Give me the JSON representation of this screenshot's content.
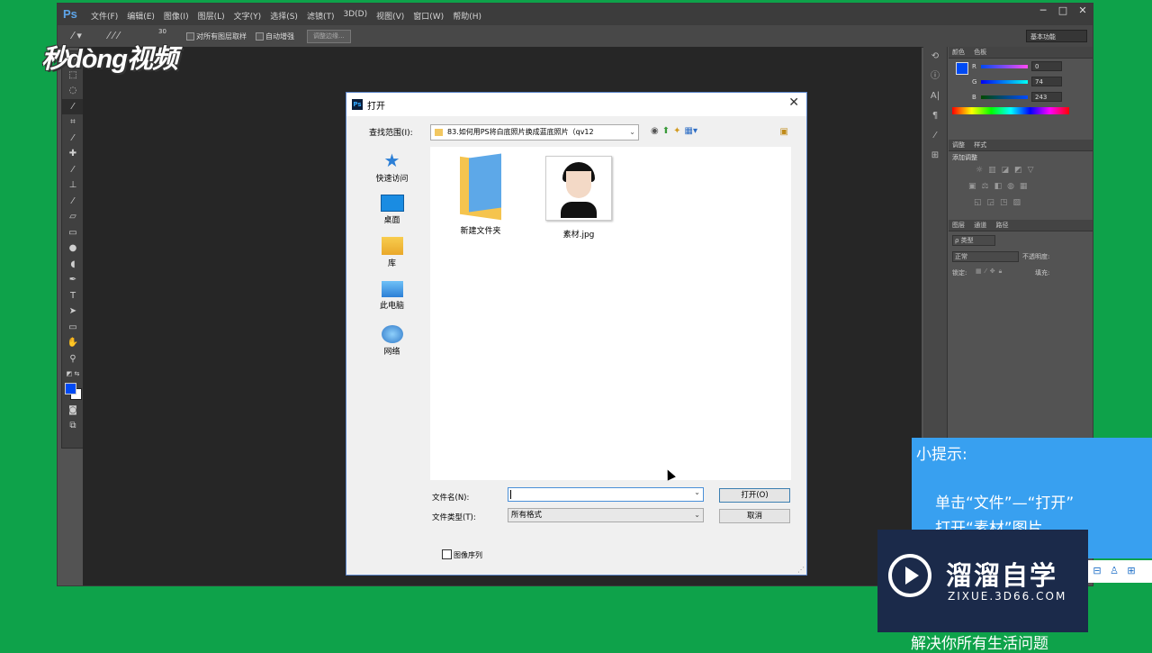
{
  "ps_window": {
    "logo": "Ps",
    "menu": [
      "文件(F)",
      "编辑(E)",
      "图像(I)",
      "图层(L)",
      "文字(Y)",
      "选择(S)",
      "滤镜(T)",
      "3D(D)",
      "视图(V)",
      "窗口(W)",
      "帮助(H)"
    ],
    "window_controls": [
      "─",
      "□",
      "✕"
    ],
    "options_bar": {
      "brush_size": "30",
      "sample_all_layers": "对所有图层取样",
      "auto_enhance": "自动增强",
      "refine_edge": "调整边缘...",
      "workspace": "基本功能"
    }
  },
  "color_panel": {
    "tabs": [
      "颜色",
      "色板"
    ],
    "r_label": "R",
    "r_value": "0",
    "g_label": "G",
    "g_value": "74",
    "b_label": "B",
    "b_value": "243",
    "foreground": "#004af3"
  },
  "adjust_panel": {
    "tabs": [
      "调整",
      "样式"
    ],
    "title": "添加调整"
  },
  "layers_panel": {
    "tabs": [
      "图层",
      "通道",
      "路径"
    ],
    "kind": "ρ 类型",
    "blend_mode": "正常",
    "opacity_label": "不透明度:",
    "lock_label": "锁定:",
    "fill_label": "填充:"
  },
  "dialog": {
    "title": "打开",
    "look_in_label": "查找范围(I):",
    "look_in_value": "83.如何用PS将白底照片换成蓝底照片（qv12",
    "places": [
      {
        "label": "快速访问",
        "icon": "star-icon"
      },
      {
        "label": "桌面",
        "icon": "desktop-icon"
      },
      {
        "label": "库",
        "icon": "library-icon"
      },
      {
        "label": "此电脑",
        "icon": "computer-icon"
      },
      {
        "label": "网络",
        "icon": "network-icon"
      }
    ],
    "files": [
      {
        "name": "新建文件夹",
        "type": "folder"
      },
      {
        "name": "素材.jpg",
        "type": "image"
      }
    ],
    "filename_label": "文件名(N):",
    "filename_value": "",
    "filetype_label": "文件类型(T):",
    "filetype_value": "所有格式",
    "open_button": "打开(O)",
    "cancel_button": "取消",
    "image_sequence": "图像序列"
  },
  "overlay": {
    "logo_top": "秒dòng视频",
    "tip_title": "小提示:",
    "tip_line1": "单击“文件”—“打开”",
    "tip_line2": "打开“素材”图片",
    "watermark_title": "溜溜自学",
    "watermark_url": "ZIXUE.3D66.COM",
    "bottom_caption": "解决你所有生活问题"
  }
}
